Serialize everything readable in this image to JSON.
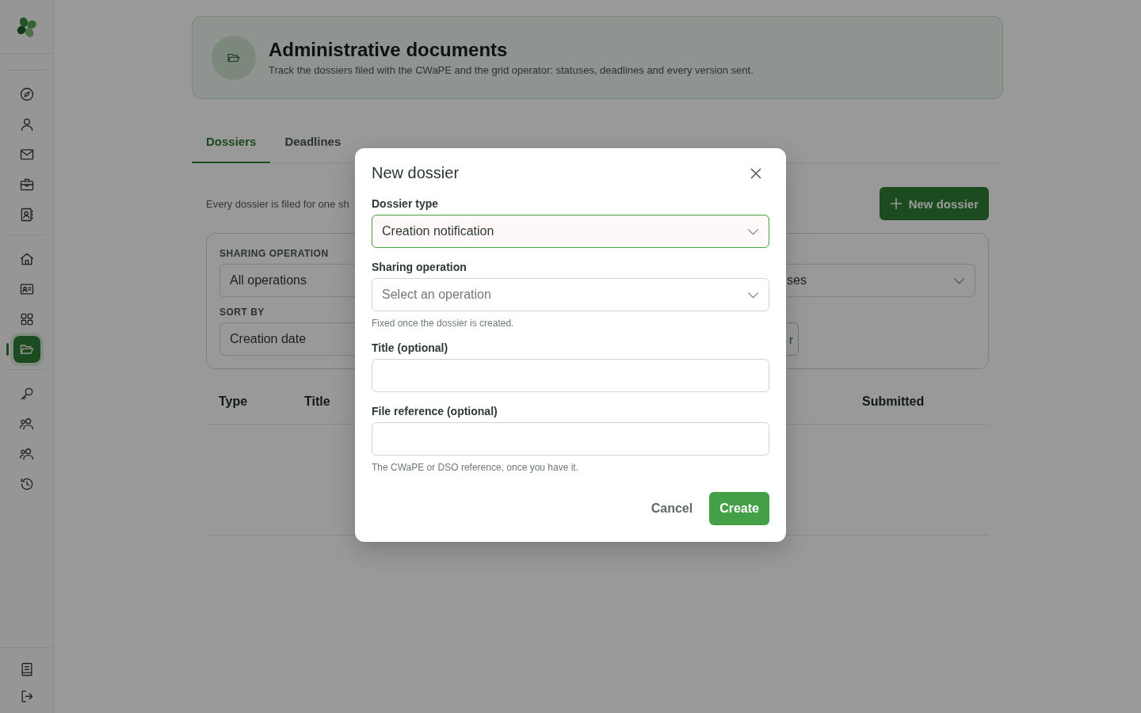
{
  "sidebar": {
    "groups": [
      [
        {
          "kind": "compass",
          "selected": false
        },
        {
          "kind": "user",
          "selected": false
        },
        {
          "kind": "mail",
          "selected": false
        },
        {
          "kind": "briefcase",
          "selected": false
        },
        {
          "kind": "contacts",
          "selected": false
        }
      ],
      [
        {
          "kind": "home",
          "selected": false
        },
        {
          "kind": "id-card",
          "selected": false
        },
        {
          "kind": "grid",
          "selected": false
        },
        {
          "kind": "folder",
          "selected": true
        }
      ],
      [
        {
          "kind": "key",
          "selected": false
        },
        {
          "kind": "users",
          "selected": false
        },
        {
          "kind": "users",
          "selected": false
        },
        {
          "kind": "history",
          "selected": false
        }
      ]
    ],
    "footer": [
      {
        "kind": "book"
      },
      {
        "kind": "logout"
      }
    ]
  },
  "header": {
    "title": "Administrative documents",
    "subtitle": "Track the dossiers filed with the CWaPE and the grid operator: statuses, deadlines and every version sent."
  },
  "tabs": [
    {
      "label": "Dossiers",
      "selected": true
    },
    {
      "label": "Deadlines",
      "selected": false
    }
  ],
  "intro": "Every dossier is filed for one sh",
  "new_button": "New dossier",
  "filters": {
    "sharing_label": "SHARING OPERATION",
    "sharing_value": "All operations",
    "status_value": "ses",
    "sort_label": "SORT BY",
    "sort_value": "Creation date",
    "reset_button": "r"
  },
  "table": {
    "columns": [
      "Type",
      "Title",
      "Submitted"
    ]
  },
  "dialog": {
    "title": "New dossier",
    "fields": [
      {
        "kind": "select",
        "label": "Dossier type",
        "value": "Creation notification",
        "focused": true
      },
      {
        "kind": "select",
        "label": "Sharing operation",
        "placeholder": "Select an operation",
        "hint": "Fixed once the dossier is created.",
        "focused": false
      },
      {
        "kind": "text",
        "label": "Title (optional)",
        "focused": false
      },
      {
        "kind": "text",
        "label": "File reference (optional)",
        "hint": "The CWaPE or DSO reference, once you have it.",
        "focused": false
      }
    ],
    "cancel": "Cancel",
    "submit": "Create"
  }
}
